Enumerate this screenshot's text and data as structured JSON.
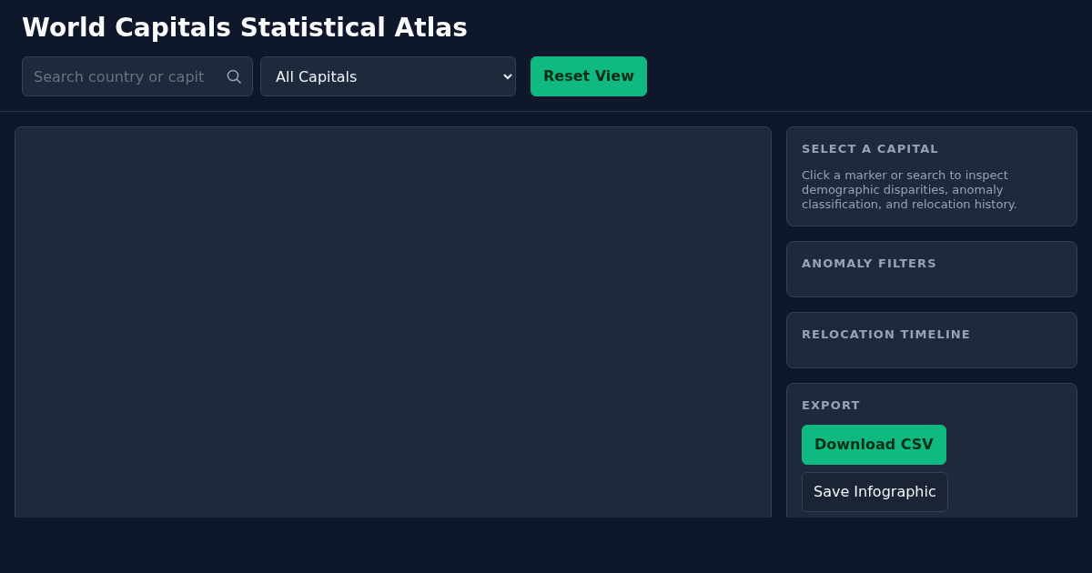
{
  "title": "World Capitals Statistical Atlas",
  "search": {
    "placeholder": "Search country or capit"
  },
  "filter": {
    "value": "All Capitals"
  },
  "reset_button": "Reset View",
  "panels": [
    {
      "title": "SELECT A CAPITAL",
      "text": "Click a marker or search to inspect demographic disparities, anomaly classification, and relocation history."
    },
    {
      "title": "ANOMALY FILTERS"
    },
    {
      "title": "RELOCATION TIMELINE"
    },
    {
      "title": "EXPORT",
      "buttons": [
        {
          "label": "Download CSV",
          "kind": "primary"
        },
        {
          "label": "Save Infographic",
          "kind": "outline"
        }
      ]
    }
  ]
}
